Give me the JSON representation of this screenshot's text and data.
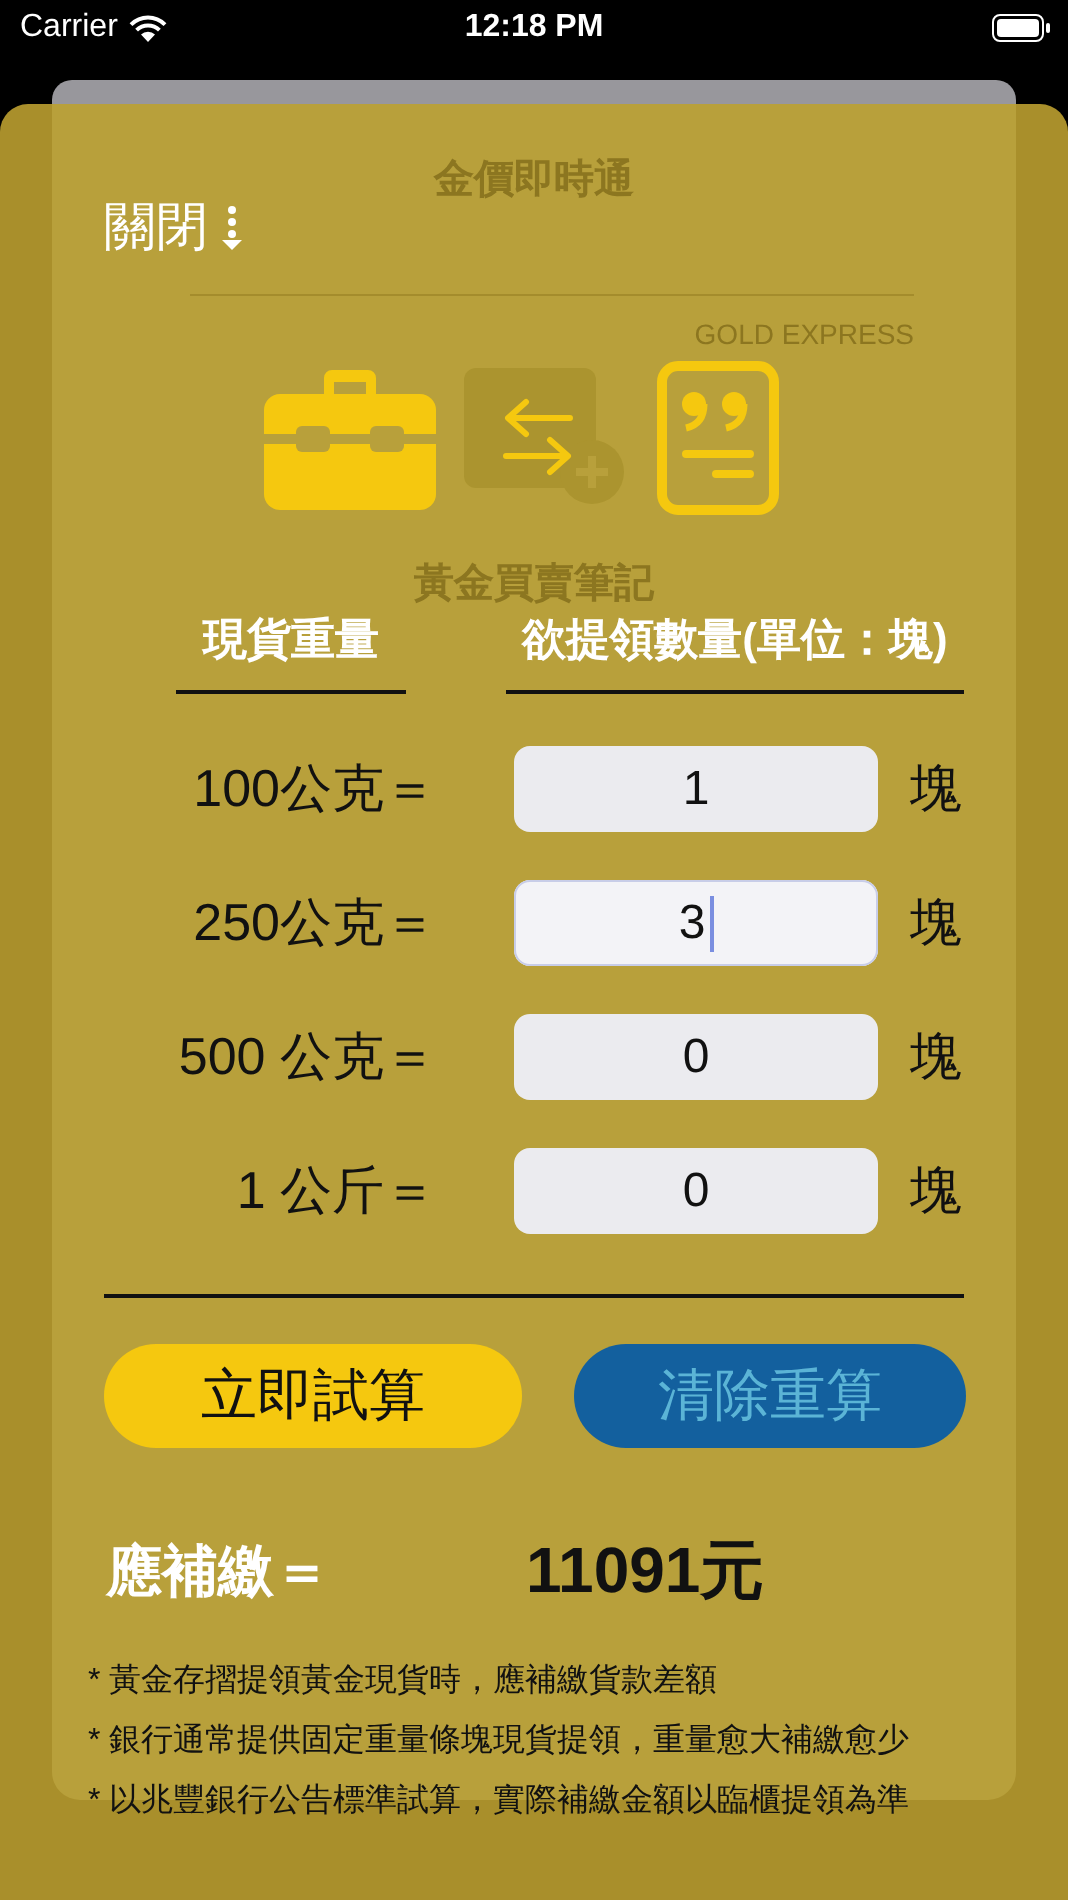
{
  "status_bar": {
    "carrier": "Carrier",
    "time": "12:18 PM"
  },
  "background": {
    "title": "金價即時通",
    "subtitle": "GOLD EXPRESS",
    "caption": "黃金買賣筆記"
  },
  "close_button": {
    "label": "關閉"
  },
  "headers": [
    "現貨重量",
    "欲提領數量(單位：塊)"
  ],
  "rows": [
    {
      "label": "100公克＝",
      "value": "1",
      "unit": "塊",
      "focused": false
    },
    {
      "label": "250公克＝",
      "value": "3",
      "unit": "塊",
      "focused": true
    },
    {
      "label": "500 公克＝",
      "value": "0",
      "unit": "塊",
      "focused": false
    },
    {
      "label": "1 公斤＝",
      "value": "0",
      "unit": "塊",
      "focused": false
    }
  ],
  "buttons": [
    {
      "label": "立即試算",
      "kind": "primary"
    },
    {
      "label": "清除重算",
      "kind": "secondary"
    }
  ],
  "result": {
    "label": "應補繳＝",
    "value": "11091元"
  },
  "notes": [
    "* 黃金存摺提領黃金現貨時，應補繳貨款差額",
    "* 銀行通常提供固定重量條塊現貨提領，重量愈大補繳愈少",
    "* 以兆豐銀行公告標準試算，實際補繳金額以臨櫃提領為準"
  ]
}
